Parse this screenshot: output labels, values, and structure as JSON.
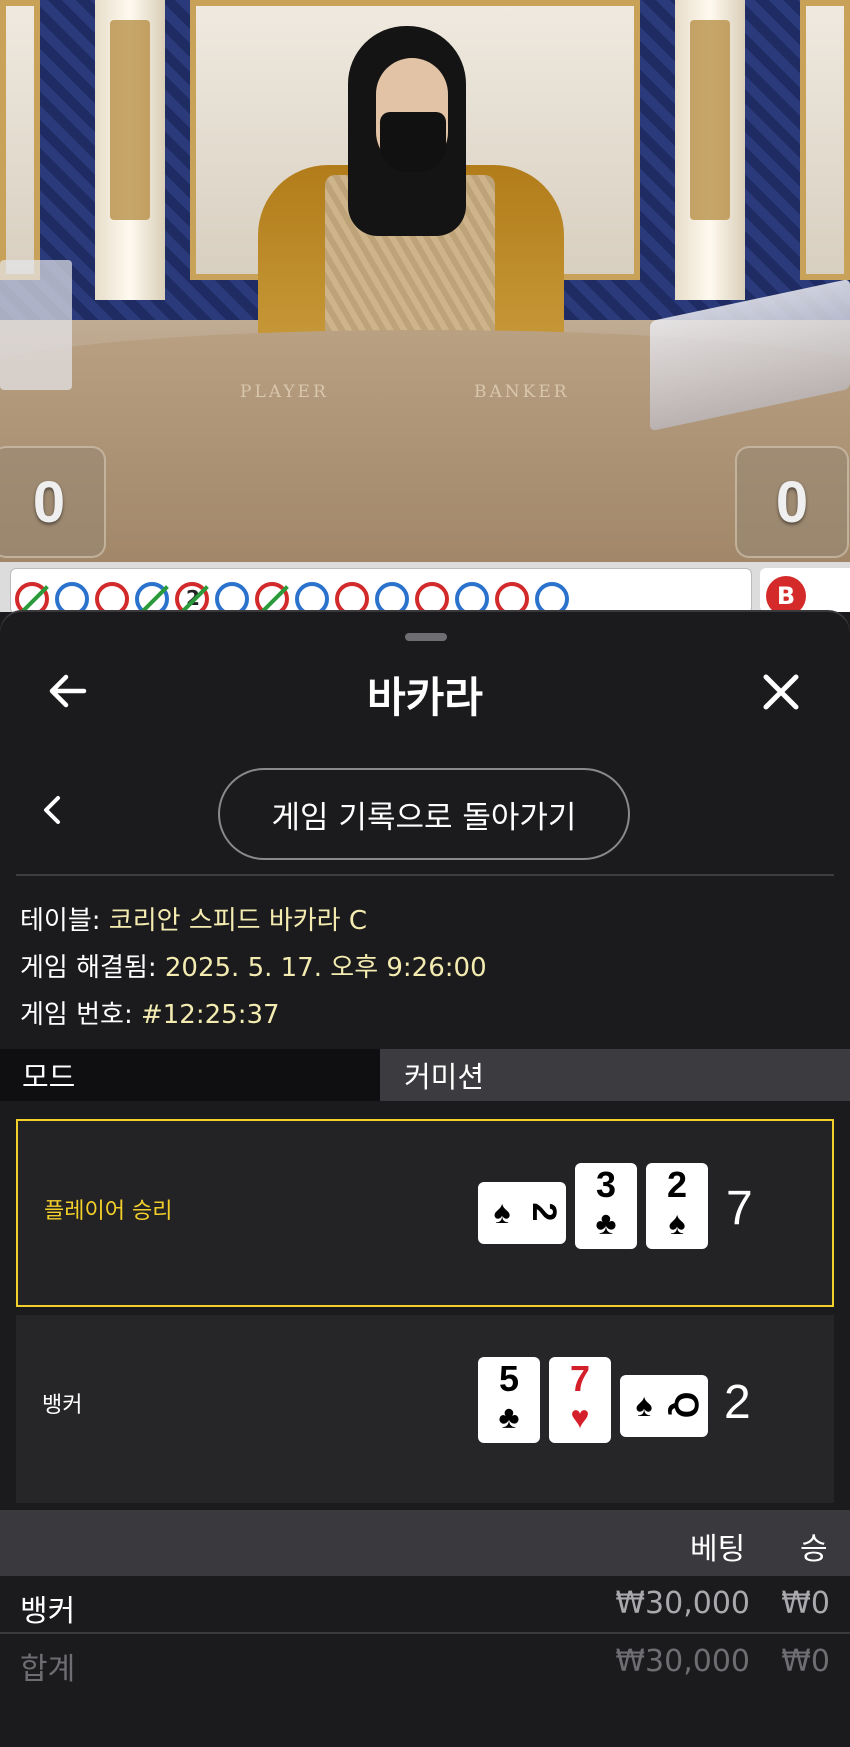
{
  "video": {
    "table_labels": {
      "player": "PLAYER",
      "banker": "BANKER"
    },
    "player_score": "0",
    "banker_score": "0"
  },
  "road": {
    "count_badge": "2",
    "right_badge": "B",
    "colors": {
      "player": "#2a72cc",
      "banker": "#d22a2a",
      "tie": "#2a9a3a"
    }
  },
  "sheet": {
    "title": "바카라",
    "back_icon": "arrow-left-icon",
    "close_icon": "close-icon",
    "history_button": "게임 기록으로 돌아가기",
    "info": {
      "table_label": "테이블:",
      "table_value": "코리안 스피드 바카라 C",
      "resolved_label": "게임 해결됨:",
      "resolved_value": "2025. 5. 17. 오후 9:26:00",
      "game_no_label": "게임 번호:",
      "game_no_value": "#12:25:37"
    },
    "modes": {
      "active": "모드",
      "inactive": "커미션"
    },
    "results": {
      "player": {
        "label": "플레이어 승리",
        "total": "7",
        "cards": [
          {
            "rank": "2",
            "suit": "♠",
            "orientation": "sideways"
          },
          {
            "rank": "3",
            "suit": "♣"
          },
          {
            "rank": "2",
            "suit": "♠"
          }
        ]
      },
      "banker": {
        "label": "뱅커",
        "total": "2",
        "cards": [
          {
            "rank": "5",
            "suit": "♣"
          },
          {
            "rank": "7",
            "suit": "♥",
            "color": "#d4202a"
          },
          {
            "rank": "Q",
            "suit": "♠",
            "orientation": "sideways"
          }
        ]
      }
    },
    "accent": "#f3cf2b",
    "bets": {
      "header": {
        "bet": "베팅",
        "win": "승"
      },
      "rows": [
        {
          "name": "뱅커",
          "bet": "₩30,000",
          "win": "₩0"
        }
      ],
      "total": {
        "name": "합계",
        "bet": "₩30,000",
        "win": "₩0"
      }
    }
  }
}
